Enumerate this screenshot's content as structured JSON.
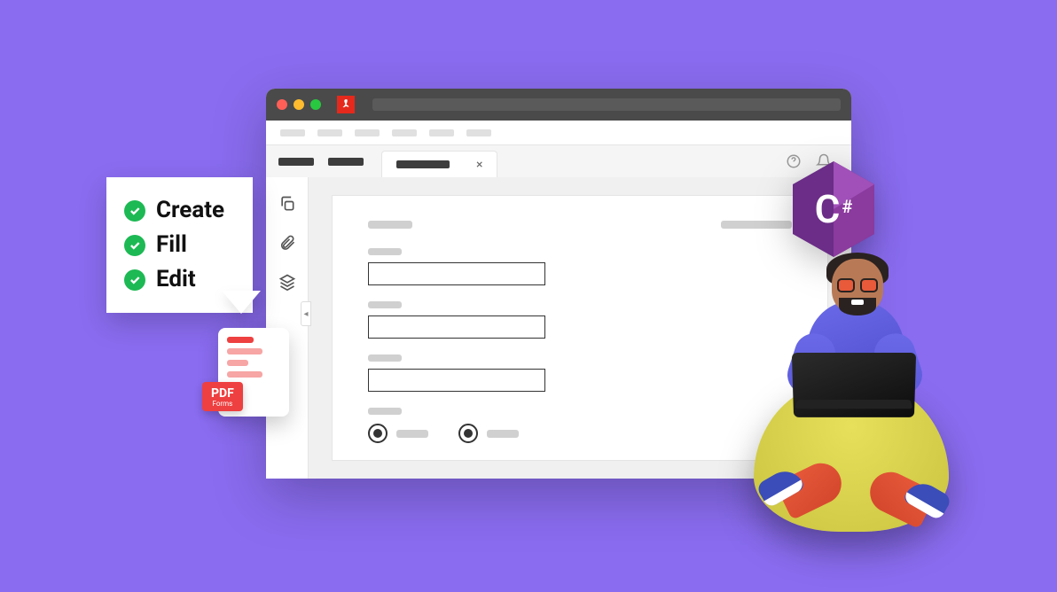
{
  "checklist": {
    "items": [
      "Create",
      "Fill",
      "Edit"
    ]
  },
  "pdf_badge": {
    "title": "PDF",
    "subtitle": "Forms"
  },
  "csharp": {
    "letter": "C",
    "symbol": "#"
  },
  "colors": {
    "bg": "#8a6cf0",
    "accent_green": "#1db954",
    "accent_red": "#ee4040",
    "csharp_purple": "#8b3a9e"
  }
}
